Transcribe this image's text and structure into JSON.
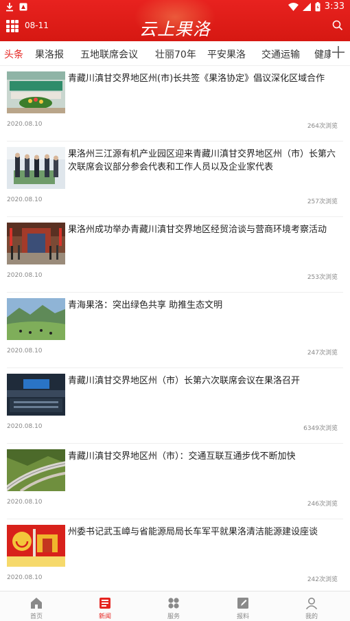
{
  "status_bar": {
    "time": "3:33",
    "icons": [
      "download-icon",
      "app-notification-icon",
      "wifi-icon",
      "signal-icon",
      "battery-icon"
    ]
  },
  "header": {
    "date": "08-11",
    "title": "云上果洛",
    "menu_icon": "grid-menu-icon",
    "search_icon": "search-icon"
  },
  "tabs": [
    {
      "label": "头条",
      "active": true
    },
    {
      "label": "果洛报",
      "active": false
    },
    {
      "label": "五地联席会议",
      "active": false
    },
    {
      "label": "壮丽70年",
      "active": false
    },
    {
      "label": "平安果洛",
      "active": false
    },
    {
      "label": "交通运输",
      "active": false
    },
    {
      "label": "健康",
      "active": false
    }
  ],
  "news": [
    {
      "title": "青藏川滇甘交界地区州(市)长共签《果洛协定》倡议深化区域合作",
      "date": "2020.08.10",
      "views": "264次浏览",
      "thumb": "conference-flowers"
    },
    {
      "title": "果洛州三江源有机产业园区迎来青藏川滇甘交界地区州（市）长第六次联席会议部分参会代表和工作人员以及企业家代表",
      "date": "2020.08.10",
      "views": "257次浏览",
      "thumb": "visitors-model"
    },
    {
      "title": "果洛州成功举办青藏川滇甘交界地区经贸洽谈与营商环境考察活动",
      "date": "2020.08.10",
      "views": "253次浏览",
      "thumb": "building-entrance"
    },
    {
      "title": "青海果洛：突出绿色共享 助推生态文明",
      "date": "2020.08.10",
      "views": "247次浏览",
      "thumb": "grassland-yaks"
    },
    {
      "title": "青藏川滇甘交界地区州（市）长第六次联席会议在果洛召开",
      "date": "2020.08.10",
      "views": "6349次浏览",
      "thumb": "meeting-hall"
    },
    {
      "title": "青藏川滇甘交界地区州（市）：交通互联互通步伐不断加快",
      "date": "2020.08.10",
      "views": "246次浏览",
      "thumb": "highway-mountains"
    },
    {
      "title": "州委书记武玉嶂与省能源局局长车军平就果洛清洁能源建设座谈",
      "date": "2020.08.10",
      "views": "242次浏览",
      "thumb": "party-banner"
    }
  ],
  "bottom_nav": [
    {
      "label": "首页",
      "icon": "home-icon",
      "active": false
    },
    {
      "label": "新闻",
      "icon": "news-icon",
      "active": true
    },
    {
      "label": "服务",
      "icon": "services-icon",
      "active": false
    },
    {
      "label": "报料",
      "icon": "report-icon",
      "active": false
    },
    {
      "label": "我的",
      "icon": "profile-icon",
      "active": false
    }
  ],
  "colors": {
    "brand_red": "#e5231f",
    "header_red": "#d61812"
  }
}
